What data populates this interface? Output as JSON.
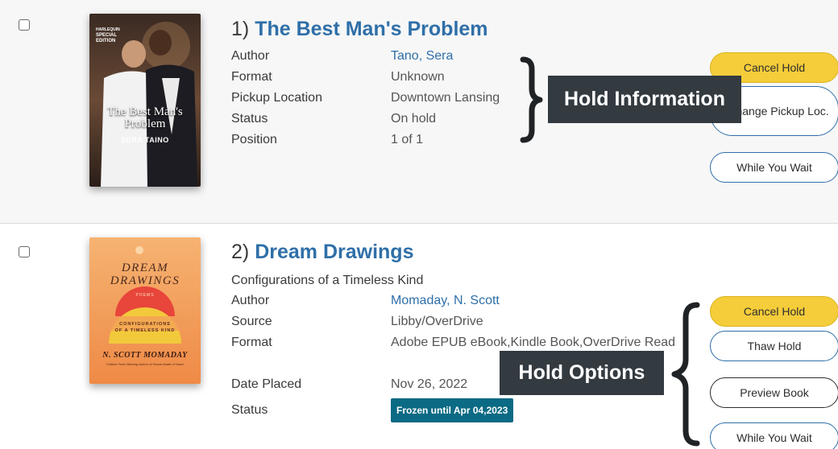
{
  "holds": [
    {
      "number": "1)",
      "title": "The Best Man's Problem",
      "cover": {
        "imprint": "HARLEQUIN",
        "line": "SPECIAL EDITION",
        "title_line1": "The Best Man's",
        "title_line2": "Problem",
        "author": "SERA TAINO"
      },
      "details": [
        {
          "label": "Author",
          "value": "Tano, Sera"
        },
        {
          "label": "Format",
          "value": "Unknown"
        },
        {
          "label": "Pickup Location",
          "value": "Downtown Lansing"
        },
        {
          "label": "Status",
          "value": "On hold"
        },
        {
          "label": "Position",
          "value": "1 of 1"
        }
      ],
      "buttons": {
        "cancel": "Cancel Hold",
        "change_pickup": "Change Pickup Loc.",
        "while_you_wait": "While You Wait"
      }
    },
    {
      "number": "2)",
      "title": "Dream Drawings",
      "subtitle": "Configurations of a Timeless Kind",
      "cover": {
        "title_line1": "DREAM",
        "title_line2": "DRAWINGS",
        "tag": "POEMS",
        "sub_line1": "CONFIGURATIONS",
        "sub_line2": "OF A TIMELESS KIND",
        "author": "N. SCOTT MOMADAY",
        "blurb": "Pulitzer Prize-Winning Author of House Made of Dawn"
      },
      "details": [
        {
          "label": "Author",
          "value": "Momaday, N. Scott"
        },
        {
          "label": "Source",
          "value": "Libby/OverDrive"
        },
        {
          "label": "Format",
          "value": "Adobe EPUB eBook,Kindle Book,OverDrive Read"
        },
        {
          "label": "Date Placed",
          "value": "Nov 26, 2022"
        },
        {
          "label": "Status",
          "value": "Frozen until Apr 04,2023"
        }
      ],
      "buttons": {
        "cancel": "Cancel Hold",
        "thaw": "Thaw Hold",
        "preview": "Preview Book",
        "while_you_wait": "While You Wait"
      }
    }
  ],
  "callouts": {
    "hold_information": "Hold Information",
    "hold_options": "Hold Options"
  },
  "colors": {
    "link": "#2f6fa8",
    "cancel_button": "#f5cd3a",
    "frozen_badge": "#0b6a84",
    "callout": "#333a40"
  }
}
